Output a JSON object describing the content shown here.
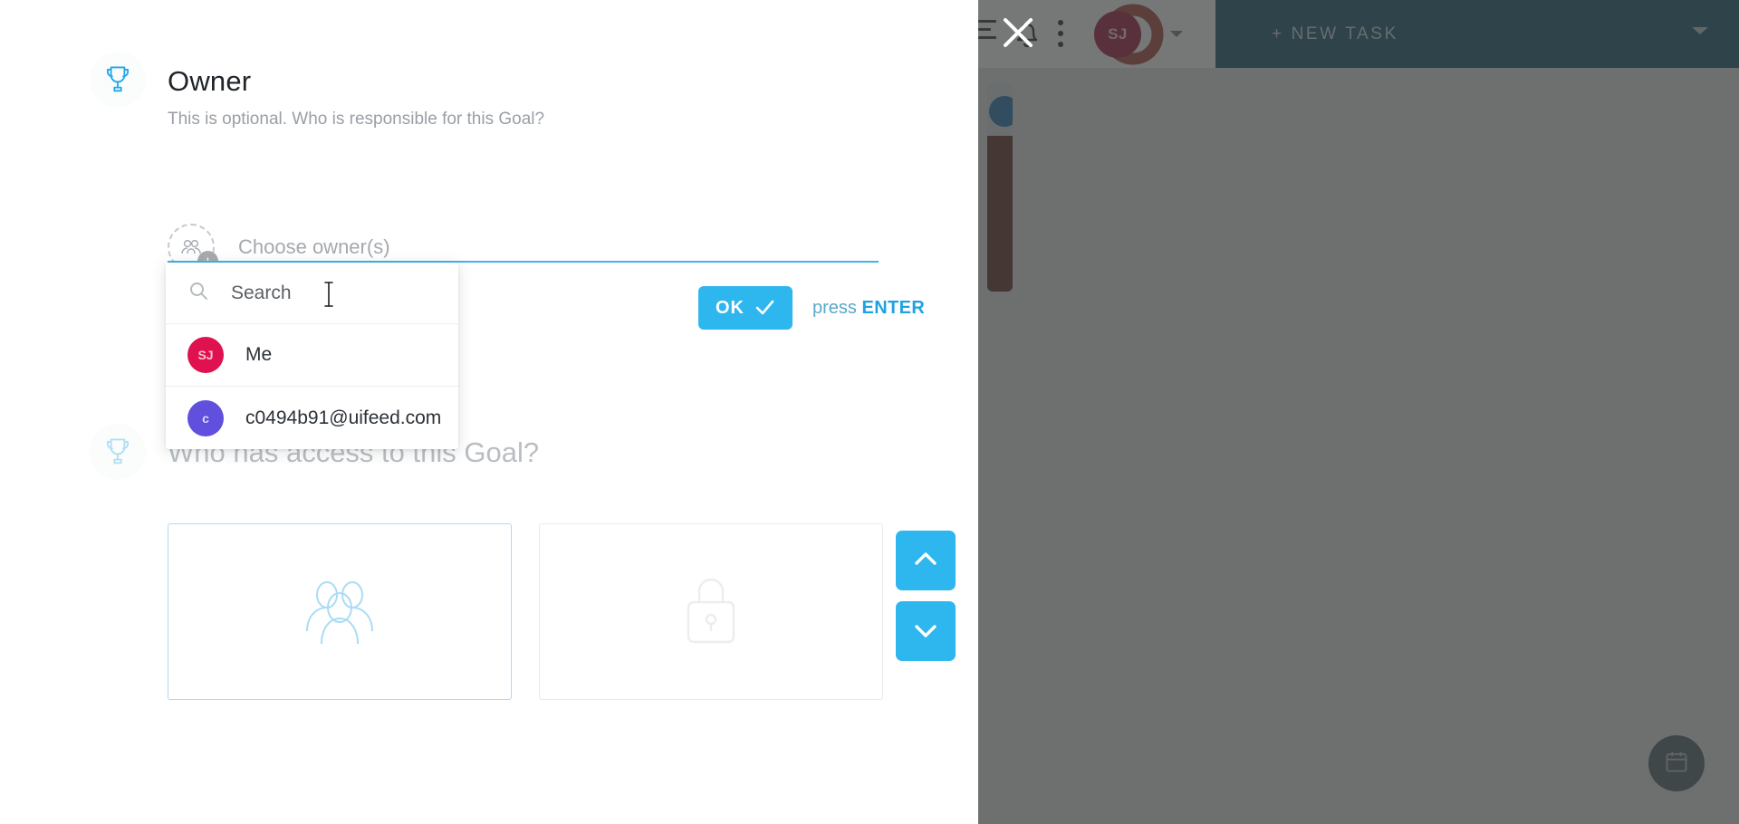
{
  "background_app": {
    "topbar": {
      "menu_icon": "hamburger-menu-icon",
      "notifications_icon": "bell-icon",
      "more_icon": "kebab-menu-icon",
      "avatar_initials": "SJ",
      "avatar_caret_icon": "chevron-down-icon",
      "new_task_label": "+ NEW TASK",
      "new_task_caret_icon": "chevron-down-icon"
    },
    "fab_icon": "calendar-icon"
  },
  "modal": {
    "close_icon": "close-x-icon",
    "owner_section": {
      "icon": "trophy-icon",
      "title": "Owner",
      "subtitle": "This is optional. Who is responsible for this Goal?",
      "chooser": {
        "icon": "add-people-icon",
        "plus_icon": "plus-icon",
        "placeholder_text": "Choose owner(s)"
      },
      "confirm": {
        "ok_label": "OK",
        "check_icon": "check-icon",
        "hint_prefix": "press ",
        "hint_key": "ENTER"
      }
    },
    "owner_dropdown": {
      "search": {
        "icon": "search-icon",
        "value": "",
        "placeholder": "Search"
      },
      "cursor_icon": "text-cursor-icon",
      "items": [
        {
          "avatar_initials": "SJ",
          "avatar_color": "#e0114f",
          "label": "Me"
        },
        {
          "avatar_initials": "c",
          "avatar_color": "#6050dd",
          "label": "c0494b91@uifeed.com"
        }
      ]
    },
    "access_section": {
      "icon": "trophy-icon",
      "title": "Who has access to this Goal?",
      "cards": [
        {
          "icon": "people-group-icon",
          "selected": true
        },
        {
          "icon": "lock-icon",
          "selected": false
        }
      ]
    },
    "scroll_controls": {
      "up_icon": "chevron-up-icon",
      "down_icon": "chevron-down-icon"
    }
  },
  "colors": {
    "accent_blue": "#2eb6ee",
    "underline_blue": "#3fb4e8",
    "new_task_bg": "#114f68",
    "avatar_pink": "#e0114f",
    "avatar_purple": "#6050dd"
  }
}
